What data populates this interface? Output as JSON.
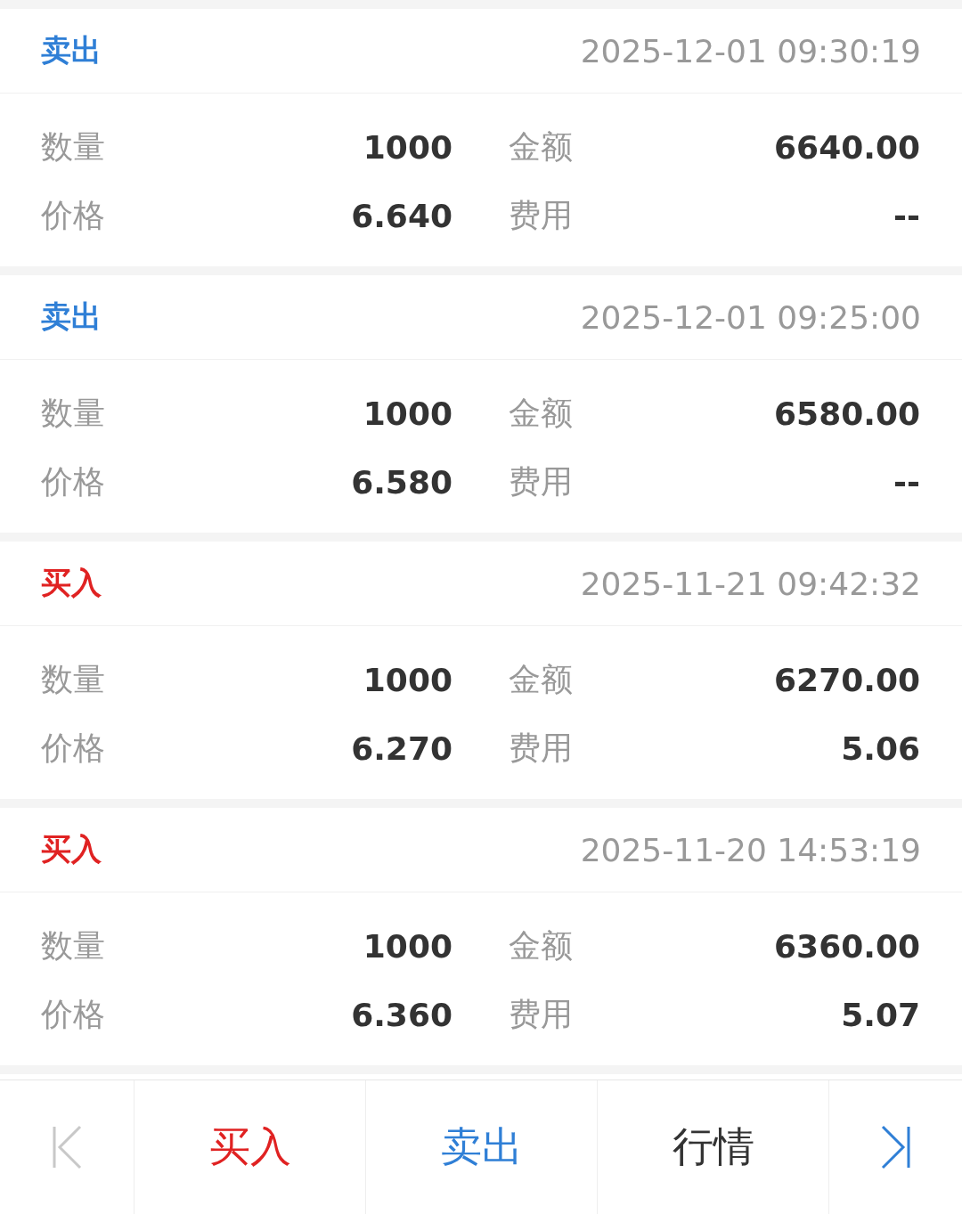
{
  "trades": [
    {
      "kind": "sell",
      "type": "卖出",
      "time": "2025-12-01 09:30:19",
      "fields": [
        {
          "label": "数量",
          "value": "1000"
        },
        {
          "label": "金额",
          "value": "6640.00"
        },
        {
          "label": "价格",
          "value": "6.640"
        },
        {
          "label": "费用",
          "value": "--"
        }
      ]
    },
    {
      "kind": "sell",
      "type": "卖出",
      "time": "2025-12-01 09:25:00",
      "fields": [
        {
          "label": "数量",
          "value": "1000"
        },
        {
          "label": "金额",
          "value": "6580.00"
        },
        {
          "label": "价格",
          "value": "6.580"
        },
        {
          "label": "费用",
          "value": "--"
        }
      ]
    },
    {
      "kind": "buy",
      "type": "买入",
      "time": "2025-11-21 09:42:32",
      "fields": [
        {
          "label": "数量",
          "value": "1000"
        },
        {
          "label": "金额",
          "value": "6270.00"
        },
        {
          "label": "价格",
          "value": "6.270"
        },
        {
          "label": "费用",
          "value": "5.06"
        }
      ]
    },
    {
      "kind": "buy",
      "type": "买入",
      "time": "2025-11-20 14:53:19",
      "fields": [
        {
          "label": "数量",
          "value": "1000"
        },
        {
          "label": "金额",
          "value": "6360.00"
        },
        {
          "label": "价格",
          "value": "6.360"
        },
        {
          "label": "费用",
          "value": "5.07"
        }
      ]
    }
  ],
  "bottom_bar": {
    "first_page": {
      "disabled": true
    },
    "actions": [
      {
        "kind": "buy",
        "label": "买入"
      },
      {
        "kind": "sell",
        "label": "卖出"
      },
      {
        "kind": "quote",
        "label": "行情"
      }
    ],
    "last_page": {
      "disabled": false
    }
  }
}
